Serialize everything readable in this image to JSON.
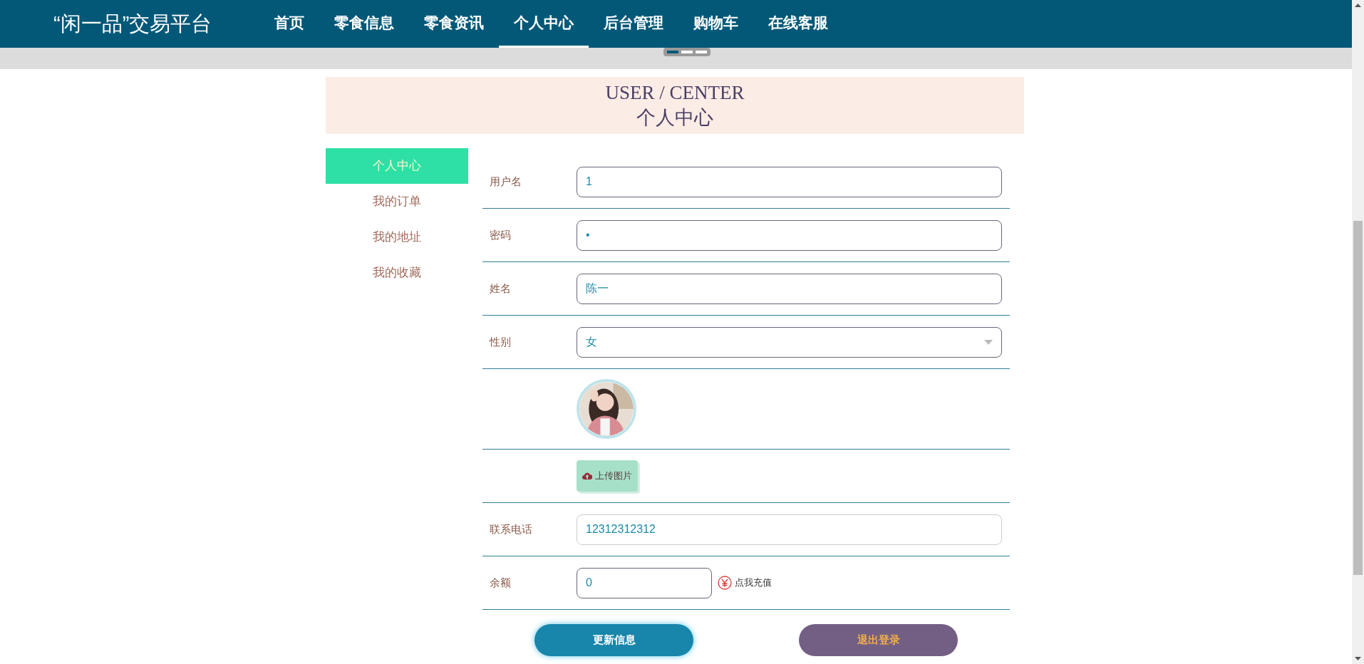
{
  "navbar": {
    "brand": "“闲一品”交易平台",
    "items": [
      {
        "label": "首页",
        "selected": false
      },
      {
        "label": "零食信息",
        "selected": false
      },
      {
        "label": "零食资讯",
        "selected": false
      },
      {
        "label": "个人中心",
        "selected": true
      },
      {
        "label": "后台管理",
        "selected": false
      },
      {
        "label": "购物车",
        "selected": false
      },
      {
        "label": "在线客服",
        "selected": false
      }
    ]
  },
  "banner": {
    "indicators": [
      {
        "selected": true
      },
      {
        "selected": false
      },
      {
        "selected": false
      }
    ]
  },
  "page_title": {
    "english": "USER / CENTER",
    "chinese": "个人中心"
  },
  "sidebar": {
    "items": [
      {
        "label": "个人中心",
        "selected": true
      },
      {
        "label": "我的订单",
        "selected": false
      },
      {
        "label": "我的地址",
        "selected": false
      },
      {
        "label": "我的收藏",
        "selected": false
      }
    ]
  },
  "form": {
    "rows": [
      {
        "kind": "text",
        "label": "用户名",
        "value": "1",
        "focused": false
      },
      {
        "kind": "text",
        "label": "密码",
        "value": "•",
        "focused": false
      },
      {
        "kind": "text",
        "label": "姓名",
        "value": "陈一",
        "focused": false
      },
      {
        "kind": "select",
        "label": "性别",
        "value": "女"
      },
      {
        "kind": "avatar"
      },
      {
        "kind": "upload",
        "button": "上传图片"
      },
      {
        "kind": "text",
        "label": "联系电话",
        "value": "12312312312",
        "focused": true
      },
      {
        "kind": "balance",
        "label": "余额",
        "value": "0",
        "link": "点我充值"
      }
    ],
    "buttons": [
      {
        "kind": "primary",
        "label": "更新信息"
      },
      {
        "kind": "secondary",
        "label": "退出登录"
      }
    ]
  }
}
